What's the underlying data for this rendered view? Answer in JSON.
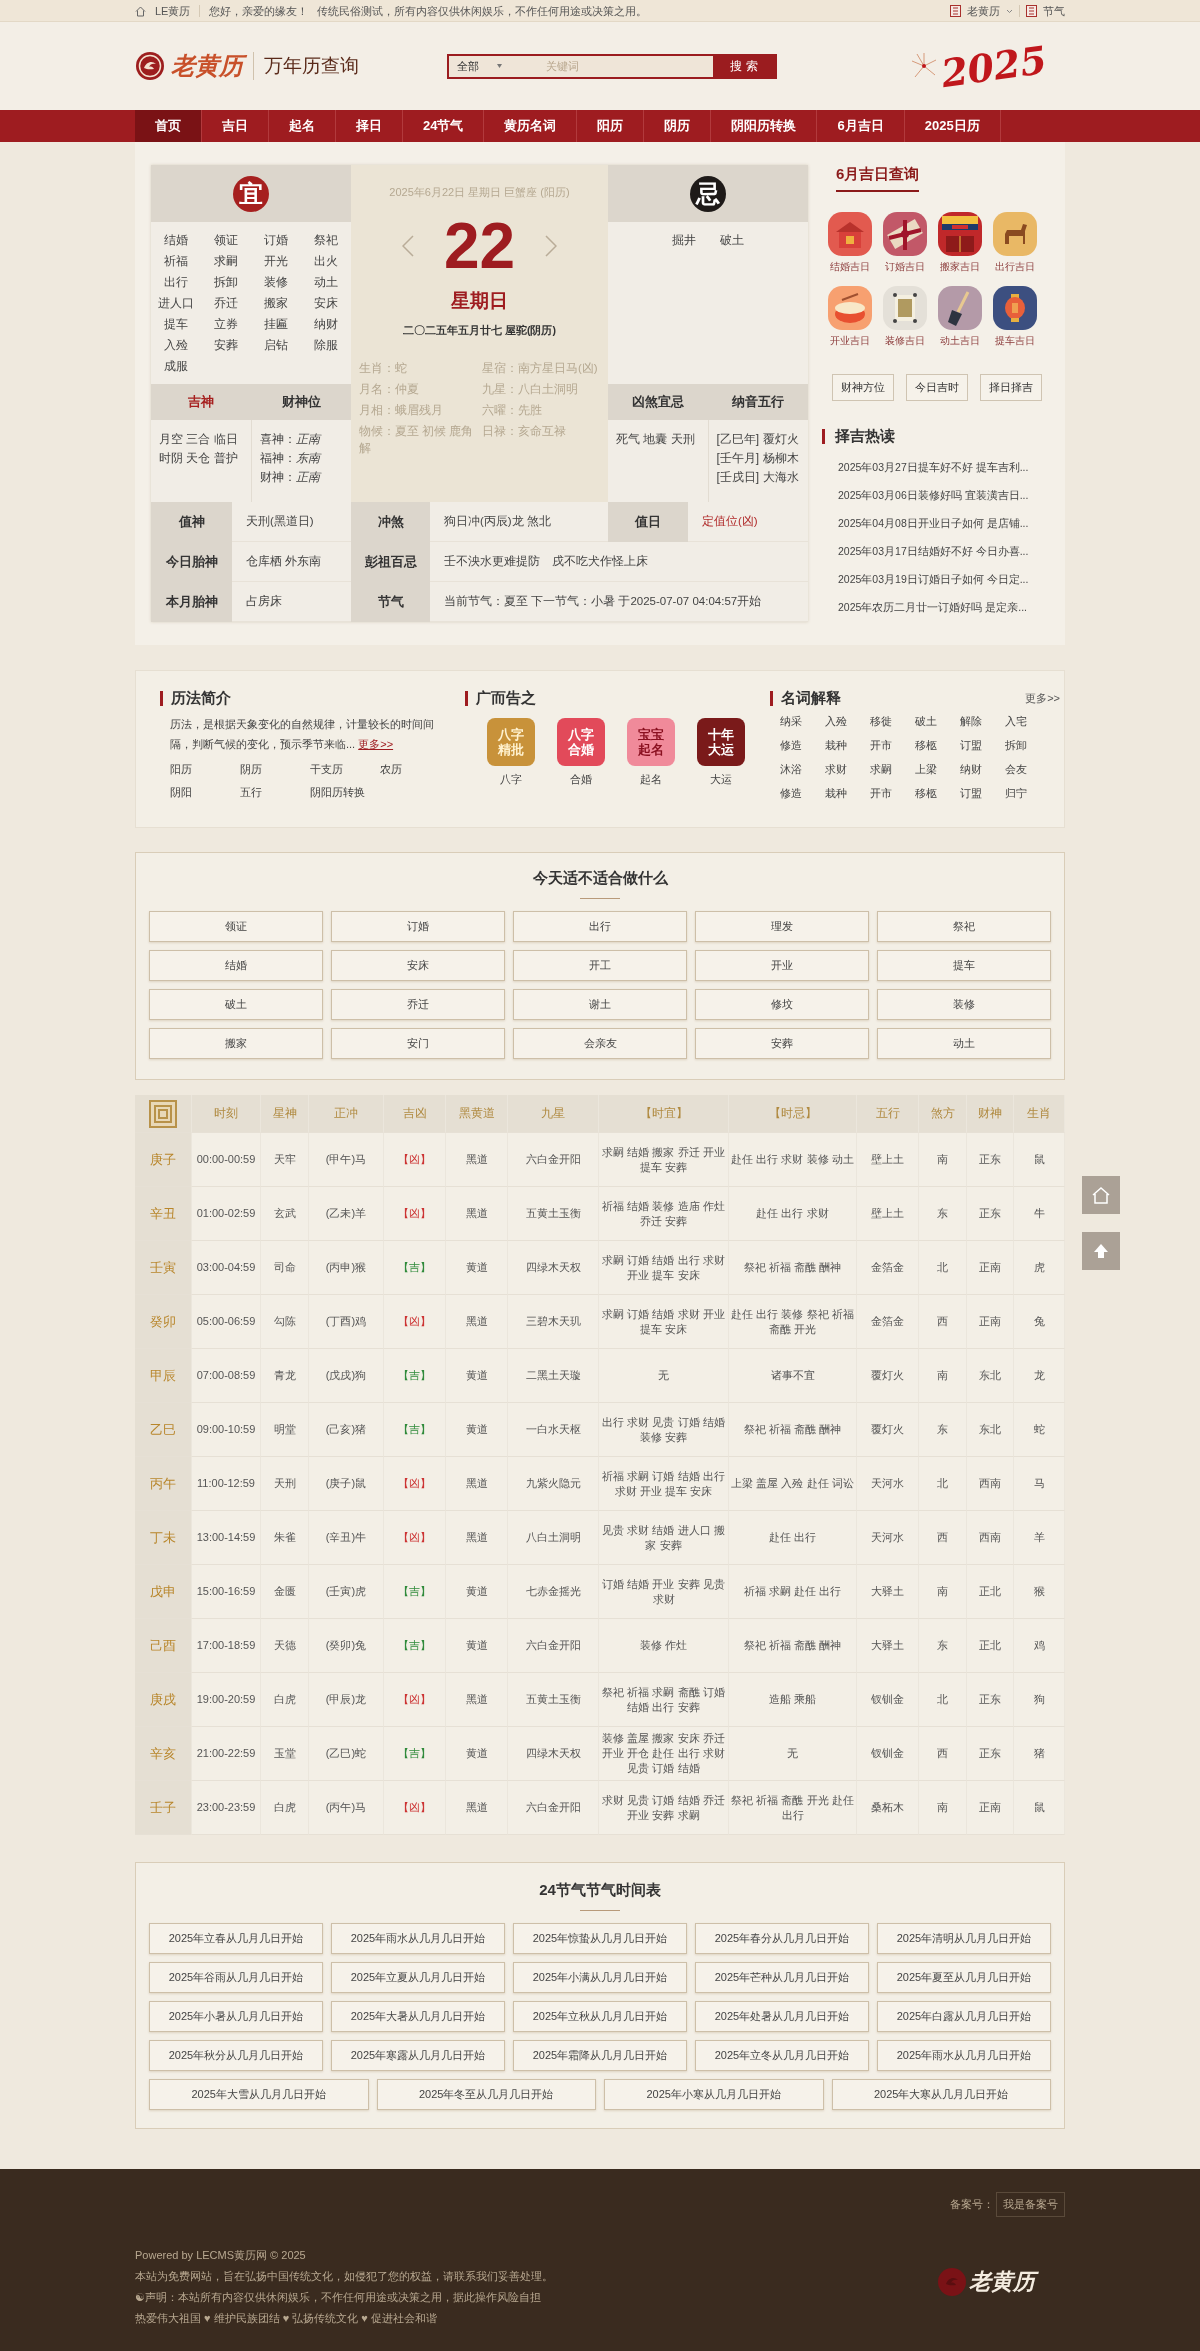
{
  "top_bar": {
    "site": "LE黄历",
    "greeting": "您好，亲爱的缘友！",
    "notice": "传统民俗测试，所有内容仅供休闲娱乐，不作任何用途或决策之用。",
    "links": [
      "老黄历",
      "节气"
    ]
  },
  "header": {
    "logo": "老黄历",
    "title": "万年历查询",
    "search": {
      "category": "全部",
      "placeholder": "关键词",
      "button": "搜 索"
    },
    "year_art": "2025"
  },
  "nav": [
    {
      "label": "首页",
      "selected": true
    },
    {
      "label": "吉日",
      "selected": false
    },
    {
      "label": "起名",
      "selected": false
    },
    {
      "label": "择日",
      "selected": false
    },
    {
      "label": "24节气",
      "selected": false
    },
    {
      "label": "黄历名词",
      "selected": false
    },
    {
      "label": "阳历",
      "selected": false
    },
    {
      "label": "阴历",
      "selected": false
    },
    {
      "label": "阴阳历转换",
      "selected": false
    },
    {
      "label": "6月吉日",
      "selected": false
    },
    {
      "label": "2025日历",
      "selected": false
    }
  ],
  "almanac": {
    "yi": {
      "badge": "宜",
      "items": [
        "结婚",
        "领证",
        "订婚",
        "祭祀",
        "祈福",
        "求嗣",
        "开光",
        "出火",
        "出行",
        "拆卸",
        "装修",
        "动土",
        "进人口",
        "乔迁",
        "搬家",
        "安床",
        "提车",
        "立券",
        "挂匾",
        "纳财",
        "入殓",
        "安葬",
        "启钻",
        "除服",
        "成服"
      ]
    },
    "ji": {
      "badge": "忌",
      "items": [
        "掘井",
        "破土"
      ]
    },
    "solar_date": "2025年6月22日 星期日 巨蟹座 (阳历)",
    "day": "22",
    "weekday": "星期日",
    "lunar_date": "二〇二五年五月廿七 屋驼(阴历)",
    "details": [
      "生肖：蛇",
      "星宿：南方星日马(凶)",
      "月名：仲夏",
      "九星：八白土洞明",
      "月相：蛾眉残月",
      "六曜：先胜",
      "物候：夏至 初候 鹿角解",
      "日禄：亥命互禄"
    ],
    "jishen": {
      "title": "吉神",
      "lines": [
        "月空 三合 临日",
        "时阴 天仓 普护"
      ]
    },
    "caishen": {
      "title": "财神位",
      "lines": [
        "喜神：*正南*",
        "福神：*东南*",
        "财神：*正南*"
      ]
    },
    "xiongsha": {
      "title": "凶煞宜忌",
      "lines": [
        "死气 地囊 天刑"
      ]
    },
    "nayin": {
      "title": "纳音五行",
      "lines": [
        "[乙巳年] 覆灯火",
        "[壬午月] 杨柳木",
        "[壬戌日] 大海水"
      ]
    },
    "info": [
      {
        "label": "值神",
        "value": "天刑(黑道日)",
        "alert": false
      },
      {
        "label": "冲煞",
        "value": "狗日冲(丙辰)龙 煞北",
        "alert": false
      },
      {
        "label": "值日",
        "value": "定值位(凶)",
        "alert": true
      },
      {
        "label": "今日胎神",
        "value": "仓库栖 外东南",
        "alert": false
      },
      {
        "label": "彭祖百忌",
        "value": "壬不泱水更难提防　戌不吃犬作怪上床",
        "alert": false
      },
      {
        "label": "本月胎神",
        "value": "占房床",
        "alert": false
      },
      {
        "label": "节气",
        "value": "当前节气：夏至 下一节气：小暑 于2025-07-07 04:04:57开始",
        "alert": false
      }
    ]
  },
  "sidebar": {
    "title": "6月吉日查询",
    "days": [
      "结婚吉日",
      "订婚吉日",
      "搬家吉日",
      "出行吉日",
      "开业吉日",
      "装修吉日",
      "动土吉日",
      "提车吉日"
    ],
    "buttons": [
      "财神方位",
      "今日吉时",
      "择日择吉"
    ],
    "hot_title": "择吉热读",
    "hot": [
      "2025年03月27日提车好不好 提车吉利...",
      "2025年03月06日装修好吗 宜装潢吉日...",
      "2025年04月08日开业日子如何 是店铺...",
      "2025年03月17日结婚好不好 今日办喜...",
      "2025年03月19日订婚日子如何 今日定...",
      "2025年农历二月廿一订婚好吗 是定亲..."
    ]
  },
  "intro": {
    "calendar": {
      "title": "历法简介",
      "text": "历法，是根据天象变化的自然规律，计量较长的时间间隔，判断气候的变化，预示季节来临...",
      "more": "更多>>",
      "links": [
        "阳历",
        "阴历",
        "干支历",
        "农历",
        "阴阳",
        "五行",
        "阴阳历转换"
      ]
    },
    "ads": {
      "title": "广而告之",
      "items": [
        {
          "logo": "八字精批",
          "label": "八字"
        },
        {
          "logo": "八字合婚",
          "label": "合婚"
        },
        {
          "logo": "宝宝起名",
          "label": "起名"
        },
        {
          "logo": "十年大运",
          "label": "大运"
        }
      ]
    },
    "terms": {
      "title": "名词解释",
      "more": "更多>>",
      "items": [
        "纳采",
        "入殓",
        "移徙",
        "破土",
        "解除",
        "入宅",
        "修造",
        "栽种",
        "开市",
        "移柩",
        "订盟",
        "拆卸",
        "沐浴",
        "求财",
        "求嗣",
        "上梁",
        "纳财",
        "会友",
        "修造",
        "栽种",
        "开市",
        "移柩",
        "订盟",
        "归宁"
      ]
    }
  },
  "unsuitable": {
    "title": "今天适不适合做什么",
    "items": [
      "领证",
      "订婚",
      "出行",
      "理发",
      "祭祀",
      "结婚",
      "安床",
      "开工",
      "开业",
      "提车",
      "破土",
      "乔迁",
      "谢土",
      "修坟",
      "装修",
      "搬家",
      "安门",
      "会亲友",
      "安葬",
      "动土"
    ]
  },
  "hours": {
    "columns": [
      "时刻",
      "星神",
      "正冲",
      "吉凶",
      "黑黄道",
      "九星",
      "【时宜】",
      "【时忌】",
      "五行",
      "煞方",
      "财神",
      "生肖"
    ],
    "rows": [
      {
        "branch": "庚子",
        "lucky": false,
        "cells": [
          "00:00-00:59",
          "天牢",
          "(甲午)马",
          "【凶】",
          "黑道",
          "六白金开阳",
          [
            "求嗣 结婚 搬家 乔迁 开业",
            "提车 安葬"
          ],
          [
            "赴任 出行 求财 装修 动土"
          ],
          "壁上土",
          "南",
          "正东",
          "鼠"
        ]
      },
      {
        "branch": "辛丑",
        "lucky": false,
        "cells": [
          "01:00-02:59",
          "玄武",
          "(乙未)羊",
          "【凶】",
          "黑道",
          "五黄土玉衡",
          [
            "祈福 结婚 装修 造庙 作灶",
            "乔迁 安葬"
          ],
          [
            "赴任 出行 求财"
          ],
          "壁上土",
          "东",
          "正东",
          "牛"
        ]
      },
      {
        "branch": "壬寅",
        "lucky": true,
        "cells": [
          "03:00-04:59",
          "司命",
          "(丙申)猴",
          "【吉】",
          "黄道",
          "四绿木天权",
          [
            "求嗣 订婚 结婚 出行 求财",
            "开业 提车 安床"
          ],
          [
            "祭祀 祈福 斋醮 酬神"
          ],
          "金箔金",
          "北",
          "正南",
          "虎"
        ]
      },
      {
        "branch": "癸卯",
        "lucky": false,
        "cells": [
          "05:00-06:59",
          "勾陈",
          "(丁酉)鸡",
          "【凶】",
          "黑道",
          "三碧木天玑",
          [
            "求嗣 订婚 结婚 求财 开业",
            "提车 安床"
          ],
          [
            "赴任 出行 装修 祭祀 祈福",
            "斋醮 开光"
          ],
          "金箔金",
          "西",
          "正南",
          "兔"
        ]
      },
      {
        "branch": "甲辰",
        "lucky": true,
        "cells": [
          "07:00-08:59",
          "青龙",
          "(戊戌)狗",
          "【吉】",
          "黄道",
          "二黑土天璇",
          [
            "无"
          ],
          [
            "诸事不宜"
          ],
          "覆灯火",
          "南",
          "东北",
          "龙"
        ]
      },
      {
        "branch": "乙巳",
        "lucky": true,
        "cells": [
          "09:00-10:59",
          "明堂",
          "(己亥)猪",
          "【吉】",
          "黄道",
          "一白水天枢",
          [
            "出行 求财 见贵 订婚 结婚",
            "装修 安葬"
          ],
          [
            "祭祀 祈福 斋醮 酬神"
          ],
          "覆灯火",
          "东",
          "东北",
          "蛇"
        ]
      },
      {
        "branch": "丙午",
        "lucky": false,
        "cells": [
          "11:00-12:59",
          "天刑",
          "(庚子)鼠",
          "【凶】",
          "黑道",
          "九紫火隐元",
          [
            "祈福 求嗣 订婚 结婚 出行",
            "求财 开业 提车 安床"
          ],
          [
            "上梁 盖屋 入殓 赴任 词讼"
          ],
          "天河水",
          "北",
          "西南",
          "马"
        ]
      },
      {
        "branch": "丁未",
        "lucky": false,
        "cells": [
          "13:00-14:59",
          "朱雀",
          "(辛丑)牛",
          "【凶】",
          "黑道",
          "八白土洞明",
          [
            "见贵 求财 结婚 进人口 搬",
            "家 安葬"
          ],
          [
            "赴任 出行"
          ],
          "天河水",
          "西",
          "西南",
          "羊"
        ]
      },
      {
        "branch": "戊申",
        "lucky": true,
        "cells": [
          "15:00-16:59",
          "金匮",
          "(壬寅)虎",
          "【吉】",
          "黄道",
          "七赤金摇光",
          [
            "订婚 结婚 开业 安葬 见贵",
            "求财"
          ],
          [
            "祈福 求嗣 赴任 出行"
          ],
          "大驿土",
          "南",
          "正北",
          "猴"
        ]
      },
      {
        "branch": "己酉",
        "lucky": true,
        "cells": [
          "17:00-18:59",
          "天德",
          "(癸卯)兔",
          "【吉】",
          "黄道",
          "六白金开阳",
          [
            "装修 作灶"
          ],
          [
            "祭祀 祈福 斋醮 酬神"
          ],
          "大驿土",
          "东",
          "正北",
          "鸡"
        ]
      },
      {
        "branch": "庚戌",
        "lucky": false,
        "cells": [
          "19:00-20:59",
          "白虎",
          "(甲辰)龙",
          "【凶】",
          "黑道",
          "五黄土玉衡",
          [
            "祭祀 祈福 求嗣 斋醮 订婚",
            "结婚 出行 安葬"
          ],
          [
            "造船 乘船"
          ],
          "钗钏金",
          "北",
          "正东",
          "狗"
        ]
      },
      {
        "branch": "辛亥",
        "lucky": true,
        "cells": [
          "21:00-22:59",
          "玉堂",
          "(乙巳)蛇",
          "【吉】",
          "黄道",
          "四绿木天权",
          [
            "装修 盖屋 搬家 安床 乔迁",
            "开业 开仓 赴任 出行 求财",
            "见贵 订婚 结婚"
          ],
          [
            "无"
          ],
          "钗钏金",
          "西",
          "正东",
          "猪"
        ]
      },
      {
        "branch": "壬子",
        "lucky": false,
        "cells": [
          "23:00-23:59",
          "白虎",
          "(丙午)马",
          "【凶】",
          "黑道",
          "六白金开阳",
          [
            "求财 见贵 订婚 结婚 乔迁",
            "开业 安葬 求嗣"
          ],
          [
            "祭祀 祈福 斋醮 开光 赴任",
            "出行"
          ],
          "桑柘木",
          "南",
          "正南",
          "鼠"
        ]
      }
    ]
  },
  "solar_terms": {
    "title": "24节气节气时间表",
    "items": [
      "2025年立春从几月几日开始",
      "2025年雨水从几月几日开始",
      "2025年惊蛰从几月几日开始",
      "2025年春分从几月几日开始",
      "2025年清明从几月几日开始",
      "2025年谷雨从几月几日开始",
      "2025年立夏从几月几日开始",
      "2025年小满从几月几日开始",
      "2025年芒种从几月几日开始",
      "2025年夏至从几月几日开始",
      "2025年小暑从几月几日开始",
      "2025年大暑从几月几日开始",
      "2025年立秋从几月几日开始",
      "2025年处暑从几月几日开始",
      "2025年白露从几月几日开始",
      "2025年秋分从几月几日开始",
      "2025年寒露从几月几日开始",
      "2025年霜降从几月几日开始",
      "2025年立冬从几月几日开始",
      "2025年雨水从几月几日开始",
      "2025年大雪从几月几日开始",
      "2025年冬至从几月几日开始",
      "2025年小寒从几月几日开始",
      "2025年大寒从几月几日开始"
    ]
  },
  "footer": {
    "icp_label": "备案号：",
    "icp": "我是备案号",
    "lines": [
      "Powered by LECMS黄历网 © 2025",
      "本站为免费网站，旨在弘扬中国传统文化，如侵犯了您的权益，请联系我们妥善处理。",
      "☯声明：本站所有内容仅供休闲娱乐，不作任何用途或决策之用，据此操作风险自担",
      "热爱伟大祖国 ♥ 维护民族团结 ♥ 弘扬传统文化 ♥ 促进社会和谐"
    ],
    "logo": "老黄历"
  }
}
